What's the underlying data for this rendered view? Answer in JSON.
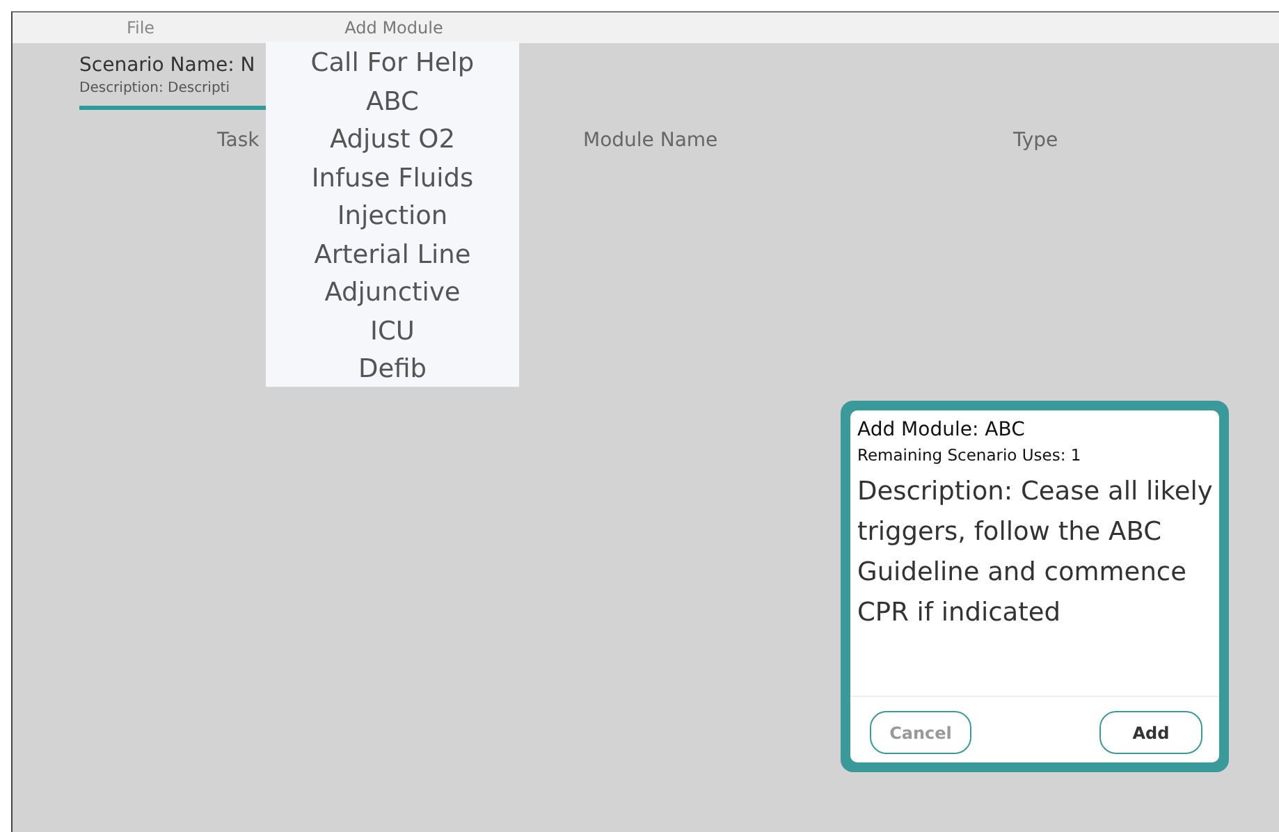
{
  "menu_bar": [
    {
      "label": "File",
      "selected": false
    },
    {
      "label": "Add Module",
      "selected": true
    }
  ],
  "scenario": {
    "name": "Scenario Name: N",
    "description": "Description: Descripti"
  },
  "table": {
    "columns": [
      "Task",
      "Module Name",
      "Type"
    ]
  },
  "dropdown": {
    "items": [
      "Call For Help",
      "ABC",
      "Adjust O2",
      "Infuse Fluids",
      "Injection",
      "Arterial Line",
      "Adjunctive",
      "ICU",
      "Defib"
    ]
  },
  "dialog": {
    "title": "Add Module: ABC",
    "uses": "Remaining Scenario Uses: 1",
    "description": "Description: Cease all likely triggers, follow the ABC Guideline and commence CPR if indicated",
    "buttons": [
      {
        "label": "Cancel",
        "kind": "secondary"
      },
      {
        "label": "Add",
        "kind": "primary"
      }
    ]
  }
}
